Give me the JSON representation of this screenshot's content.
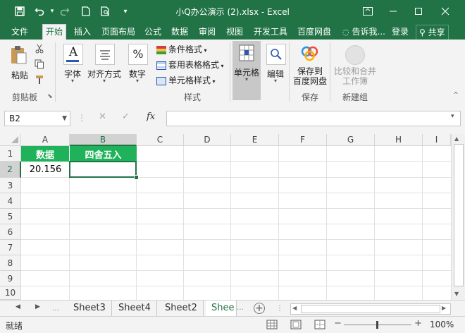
{
  "title_bar": {
    "title": "小Q办公演示 (2).xlsx - Excel",
    "icons": [
      "save-icon",
      "undo-icon",
      "redo-icon",
      "new-doc-icon",
      "print-preview-icon",
      "customize-qat-icon"
    ],
    "window_controls": [
      "ribbon-display-icon",
      "minimize-icon",
      "restore-icon",
      "close-icon"
    ]
  },
  "tabs": {
    "items": [
      "文件",
      "开始",
      "插入",
      "页面布局",
      "公式",
      "数据",
      "审阅",
      "视图",
      "开发工具",
      "百度网盘"
    ],
    "active": "开始",
    "tell_me": "告诉我...",
    "login": "登录",
    "share": "共享"
  },
  "ribbon": {
    "paste": "粘贴",
    "clipboard_group": "剪贴板",
    "font": "字体",
    "alignment": "对齐方式",
    "number": "数字",
    "conditional_format": "条件格式",
    "table_format": "套用表格格式",
    "cell_styles": "单元格样式",
    "styles_group": "样式",
    "cells": "单元格",
    "editing": "编辑",
    "save_to_baidu": "保存到\n百度网盘",
    "save_group": "保存",
    "compare_merge": "比较和合并\n工作簿",
    "new_group": "新建组",
    "font_icon_letter": "A",
    "number_icon_symbol": "%"
  },
  "formula_bar": {
    "name_box": "B2",
    "fx": "fx",
    "formula": ""
  },
  "grid": {
    "columns": [
      "A",
      "B",
      "C",
      "D",
      "E",
      "F",
      "G",
      "H",
      "I"
    ],
    "rows": [
      "1",
      "2",
      "3",
      "4",
      "5",
      "6",
      "7",
      "8",
      "9",
      "10"
    ],
    "selected_cell": "B2",
    "cells": {
      "A1": "数据",
      "B1": "四舍五入",
      "A2": "20.156",
      "B2": ""
    },
    "header_fill": "#1fb25a"
  },
  "sheets": {
    "tabs": [
      "Sheet3",
      "Sheet4",
      "Sheet2",
      "Shee"
    ],
    "active": "Shee"
  },
  "status": {
    "ready": "就绪",
    "zoom": "100%"
  }
}
